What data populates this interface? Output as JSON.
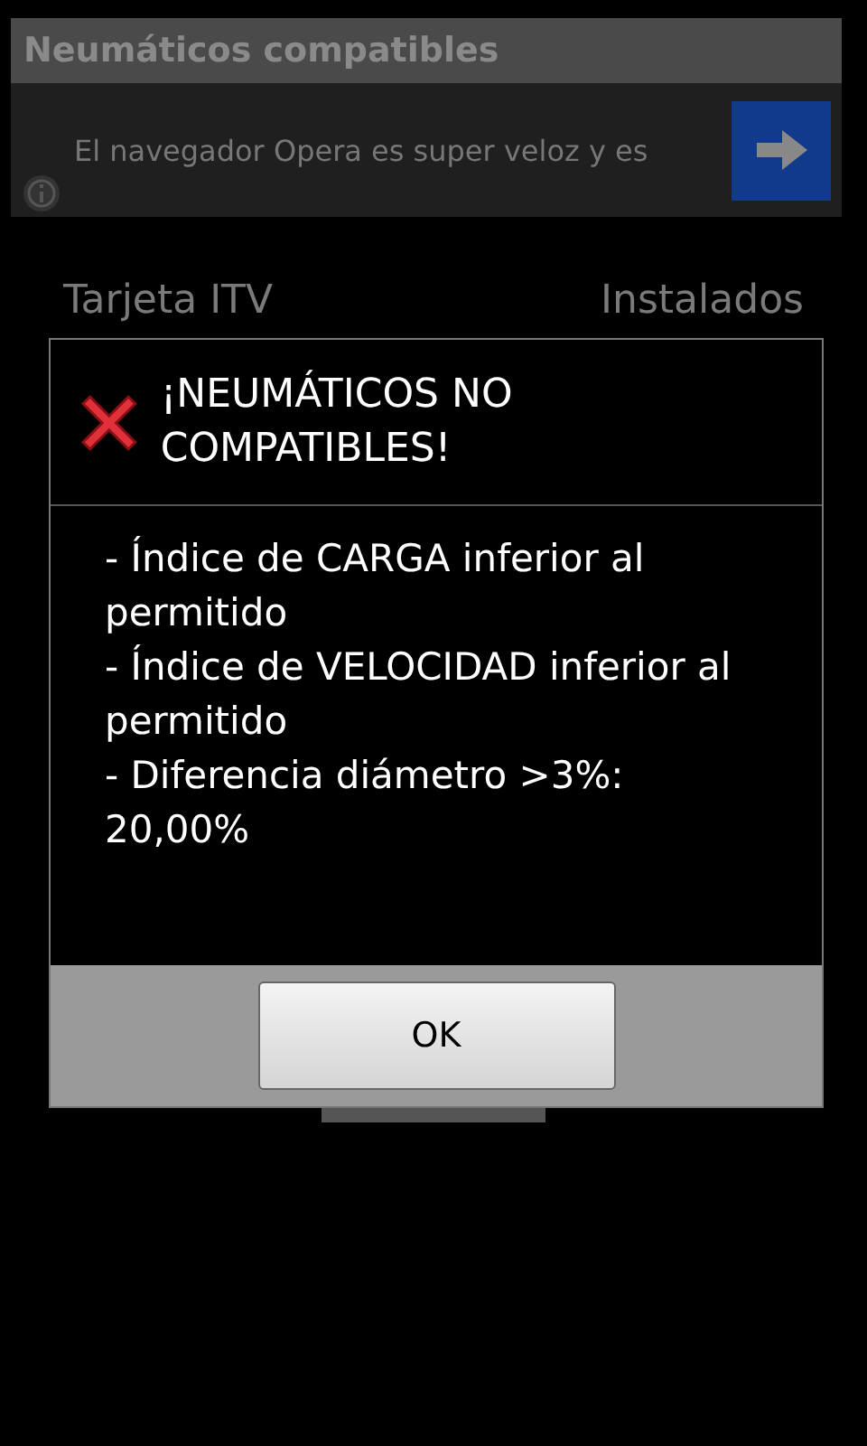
{
  "title_bar": {
    "title": "Neumáticos compatibles"
  },
  "ad": {
    "text": "El navegador Opera es super veloz y es"
  },
  "form": {
    "left_heading": "Tarjeta ITV",
    "right_heading": "Instalados"
  },
  "dialog": {
    "title": "¡NEUMÁTICOS NO COMPATIBLES!",
    "message": "- Índice de CARGA inferior al permitido\n- Índice de VELOCIDAD inferior al permitido\n- Diferencia diámetro >3%: 20,00%",
    "button": "OK"
  }
}
